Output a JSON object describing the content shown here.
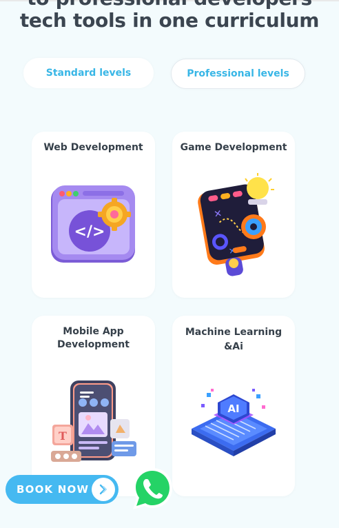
{
  "hero": {
    "line1": "to professional developers",
    "line2": "tech tools in one curriculum"
  },
  "tabs": {
    "standard": "Standard levels",
    "professional": "Professional levels"
  },
  "courses": [
    {
      "title": "Web Development",
      "icon": "web-browser-code-icon"
    },
    {
      "title": "Game Development",
      "icon": "game-controller-icon"
    },
    {
      "title_line1": "Mobile App",
      "title_line2": "Development",
      "icon": "mobile-phone-apps-icon"
    },
    {
      "title_line1": "Machine Learning",
      "title_line2": "&Ai",
      "icon": "ai-chip-icon"
    }
  ],
  "cta": {
    "book_label": "BOOK NOW",
    "whatsapp_icon": "whatsapp-icon",
    "colors": {
      "book": "#45b9f1",
      "whatsapp": "#25d366"
    }
  }
}
